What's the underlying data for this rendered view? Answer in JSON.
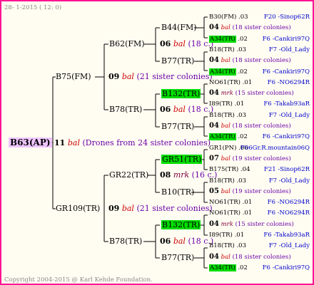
{
  "meta": {
    "date": "28- 1-2015 ( 12: 0)",
    "copyright": "Copyright 2004-2015 @ Karl Kehde Foundation."
  },
  "root": {
    "id": "B63(AP)",
    "year": "11",
    "mark": "bal",
    "note": "(Drones from 24 sister colonies)"
  },
  "gen1": [
    {
      "id": "B75(FM)",
      "year": "09",
      "mark": "bal",
      "note": "(21 sister colonies)"
    },
    {
      "id": "GR109(TR)",
      "year": "09",
      "mark": "bal",
      "note": "(21 sister colonies)"
    }
  ],
  "gen2": [
    {
      "id": "B62(FM)",
      "year": "06",
      "mark": "bal",
      "note": "(18 c.)"
    },
    {
      "id": "B78(TR)",
      "year": "06",
      "mark": "bal",
      "note": "(18 c.)"
    },
    {
      "id": "GR22(TR)",
      "year": "08",
      "mark": "mrk",
      "note": "(16 c.)"
    },
    {
      "id": "B78(TR)",
      "year": "06",
      "mark": "bal",
      "note": "(18 c.)"
    }
  ],
  "gen3": [
    {
      "id": "B44(FM)",
      "hl": false
    },
    {
      "id": "B77(TR)",
      "hl": false
    },
    {
      "id": "B132(TR)",
      "hl": true
    },
    {
      "id": "B77(TR)",
      "hl": false
    },
    {
      "id": "GR51(TR)",
      "hl": true
    },
    {
      "id": "B10(TR)",
      "hl": false
    },
    {
      "id": "B132(TR)",
      "hl": true
    },
    {
      "id": "B77(TR)",
      "hl": false
    }
  ],
  "gen4": [
    {
      "id": "B30(FM)",
      "year": ".03",
      "hl": false,
      "loc": "F20 -Sinop62R"
    },
    {
      "sub": "04",
      "mark": "bal",
      "note": "(18 sister colonies)"
    },
    {
      "id": "A34(TR)",
      "year": ".02",
      "hl": true,
      "loc": "F6 -Cankiri97Q"
    },
    {
      "id": "B18(TR)",
      "year": ".03",
      "hl": false,
      "loc": "F7 -Old_Lady"
    },
    {
      "sub": "04",
      "mark": "bal",
      "note": "(18 sister colonies)"
    },
    {
      "id": "A34(TR)",
      "year": ".02",
      "hl": true,
      "loc": "F6 -Cankiri97Q"
    },
    {
      "id": "NO61(TR)",
      "year": ".01",
      "hl": false,
      "loc": "F6 -NO6294R"
    },
    {
      "sub": "04",
      "mark": "mrk",
      "note": "(15 sister colonies)"
    },
    {
      "id": "I89(TR)",
      "year": ".01",
      "hl": false,
      "loc": "F6 -Takab93aR"
    },
    {
      "id": "B18(TR)",
      "year": ".03",
      "hl": false,
      "loc": "F7 -Old_Lady"
    },
    {
      "sub": "04",
      "mark": "bal",
      "note": "(18 sister colonies)"
    },
    {
      "id": "A34(TR)",
      "year": ".02",
      "hl": true,
      "loc": "F6 -Cankiri97Q"
    },
    {
      "id": "GR1(PN)",
      "year": ".06",
      "hl": false,
      "loc": "F06Gr.R.mountain06Q"
    },
    {
      "sub": "07",
      "mark": "bal",
      "note": "(19 sister colonies)"
    },
    {
      "id": "B175(TR)",
      "year": ".04",
      "hl": false,
      "loc": "F21 -Sinop62R"
    },
    {
      "id": "B18(TR)",
      "year": ".03",
      "hl": false,
      "loc": "F7 -Old_Lady"
    },
    {
      "sub": "05",
      "mark": "bal",
      "note": "(19 sister colonies)"
    },
    {
      "id": "NO61(TR)",
      "year": ".01",
      "hl": false,
      "loc": "F6 -NO6294R"
    },
    {
      "id": "NO61(TR)",
      "year": ".01",
      "hl": false,
      "loc": "F6 -NO6294R"
    },
    {
      "sub": "04",
      "mark": "mrk",
      "note": "(15 sister colonies)"
    },
    {
      "id": "I89(TR)",
      "year": ".01",
      "hl": false,
      "loc": "F6 -Takab93aR"
    },
    {
      "id": "B18(TR)",
      "year": ".03",
      "hl": false,
      "loc": "F7 -Old_Lady"
    },
    {
      "sub": "04",
      "mark": "bal",
      "note": "(18 sister colonies)"
    },
    {
      "id": "A34(TR)",
      "year": ".02",
      "hl": true,
      "loc": "F6 -Cankiri97Q"
    }
  ]
}
